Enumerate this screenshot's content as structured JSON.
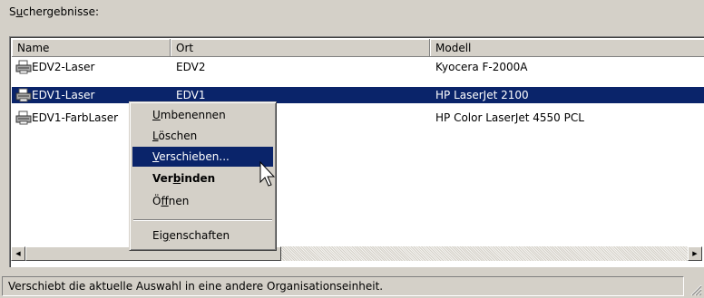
{
  "search_results_label": {
    "before": "S",
    "accel": "u",
    "after": "chergebnisse:"
  },
  "columns": {
    "name": "Name",
    "location": "Ort",
    "model": "Modell"
  },
  "rows": [
    {
      "name": "EDV2-Laser",
      "location": "EDV2",
      "model": "Kyocera F-2000A",
      "icon": "printer-icon"
    },
    {
      "name": "EDV1-Laser",
      "location": "EDV1",
      "model": "HP LaserJet 2100",
      "icon": "printer-icon",
      "selected": true
    },
    {
      "name": "EDV1-FarbLaser",
      "location": "",
      "model": "HP Color LaserJet 4550 PCL",
      "icon": "printer-icon"
    }
  ],
  "context_menu": {
    "rename": {
      "before": "",
      "accel": "U",
      "after": "mbenennen"
    },
    "delete": {
      "before": "",
      "accel": "L",
      "after": "öschen"
    },
    "move": {
      "before": "",
      "accel": "V",
      "after": "erschieben..."
    },
    "connect": {
      "before": "Ver",
      "accel": "b",
      "after": "inden"
    },
    "open": {
      "before": "Ö",
      "accel": "f",
      "after": "fnen"
    },
    "properties": {
      "before": "Ei",
      "accel": "g",
      "after": "enschaften"
    }
  },
  "status_text": "Verschiebt die aktuelle Auswahl in eine andere Organisationseinheit.",
  "colors": {
    "selection": "#0a246a",
    "face": "#d4d0c8"
  }
}
